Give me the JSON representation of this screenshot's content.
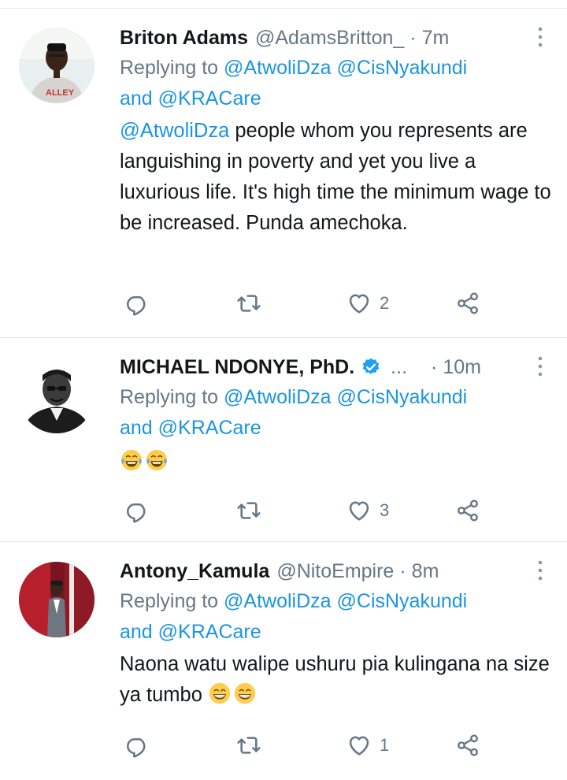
{
  "tweets": [
    {
      "name": "Briton Adams",
      "handle": "@AdamsBritton_",
      "dot": "·",
      "time": "7m",
      "replying_prefix": "Replying to",
      "reply_mention_1": "@AtwoliDza",
      "reply_mention_2": "@CisNyakundi",
      "reply_and": "and",
      "reply_mention_3": "@KRACare",
      "body_mention": "@AtwoliDza",
      "body_text": " people whom you represents are languishing in poverty and yet you live a luxurious life. It's high time the minimum wage to be increased. Punda amechoka.",
      "like_count": "2",
      "avatar_icon": "avatar-photo-white-hoodie"
    },
    {
      "name": "MICHAEL NDONYE, PhD.",
      "verified": true,
      "ellipsis": "...",
      "dot": "·",
      "time": "10m",
      "replying_prefix": "Replying to",
      "reply_mention_1": "@AtwoliDza",
      "reply_mention_2": "@CisNyakundi",
      "reply_and": "and",
      "reply_mention_3": "@KRACare",
      "body_emojis": [
        "face-with-tears-of-joy",
        "face-with-tears-of-joy"
      ],
      "like_count": "3",
      "avatar_icon": "avatar-photo-bw-portrait"
    },
    {
      "name": "Antony_Kamula",
      "handle": "@NitoEmpire",
      "dot": "·",
      "time": "8m",
      "replying_prefix": "Replying to",
      "reply_mention_1": "@AtwoliDza",
      "reply_mention_2": "@CisNyakundi",
      "reply_and": "and",
      "reply_mention_3": "@KRACare",
      "body_text": "Naona watu walipe ushuru pia kulingana na size ya tumbo ",
      "body_emojis": [
        "grinning-face-with-smiling-eyes",
        "grinning-face-with-smiling-eyes"
      ],
      "like_count": "1",
      "avatar_icon": "avatar-photo-suit-red-background"
    }
  ],
  "colors": {
    "link": "#1b95e0",
    "secondary_text": "#657786",
    "primary_text": "#14171a",
    "divider": "#e1e8ed",
    "verified": "#1da1f2"
  },
  "icons": {
    "reply": "reply-icon",
    "retweet": "retweet-icon",
    "like": "like-heart-icon",
    "share": "share-icon",
    "more": "more-vertical-icon",
    "verified": "verified-badge-icon"
  }
}
